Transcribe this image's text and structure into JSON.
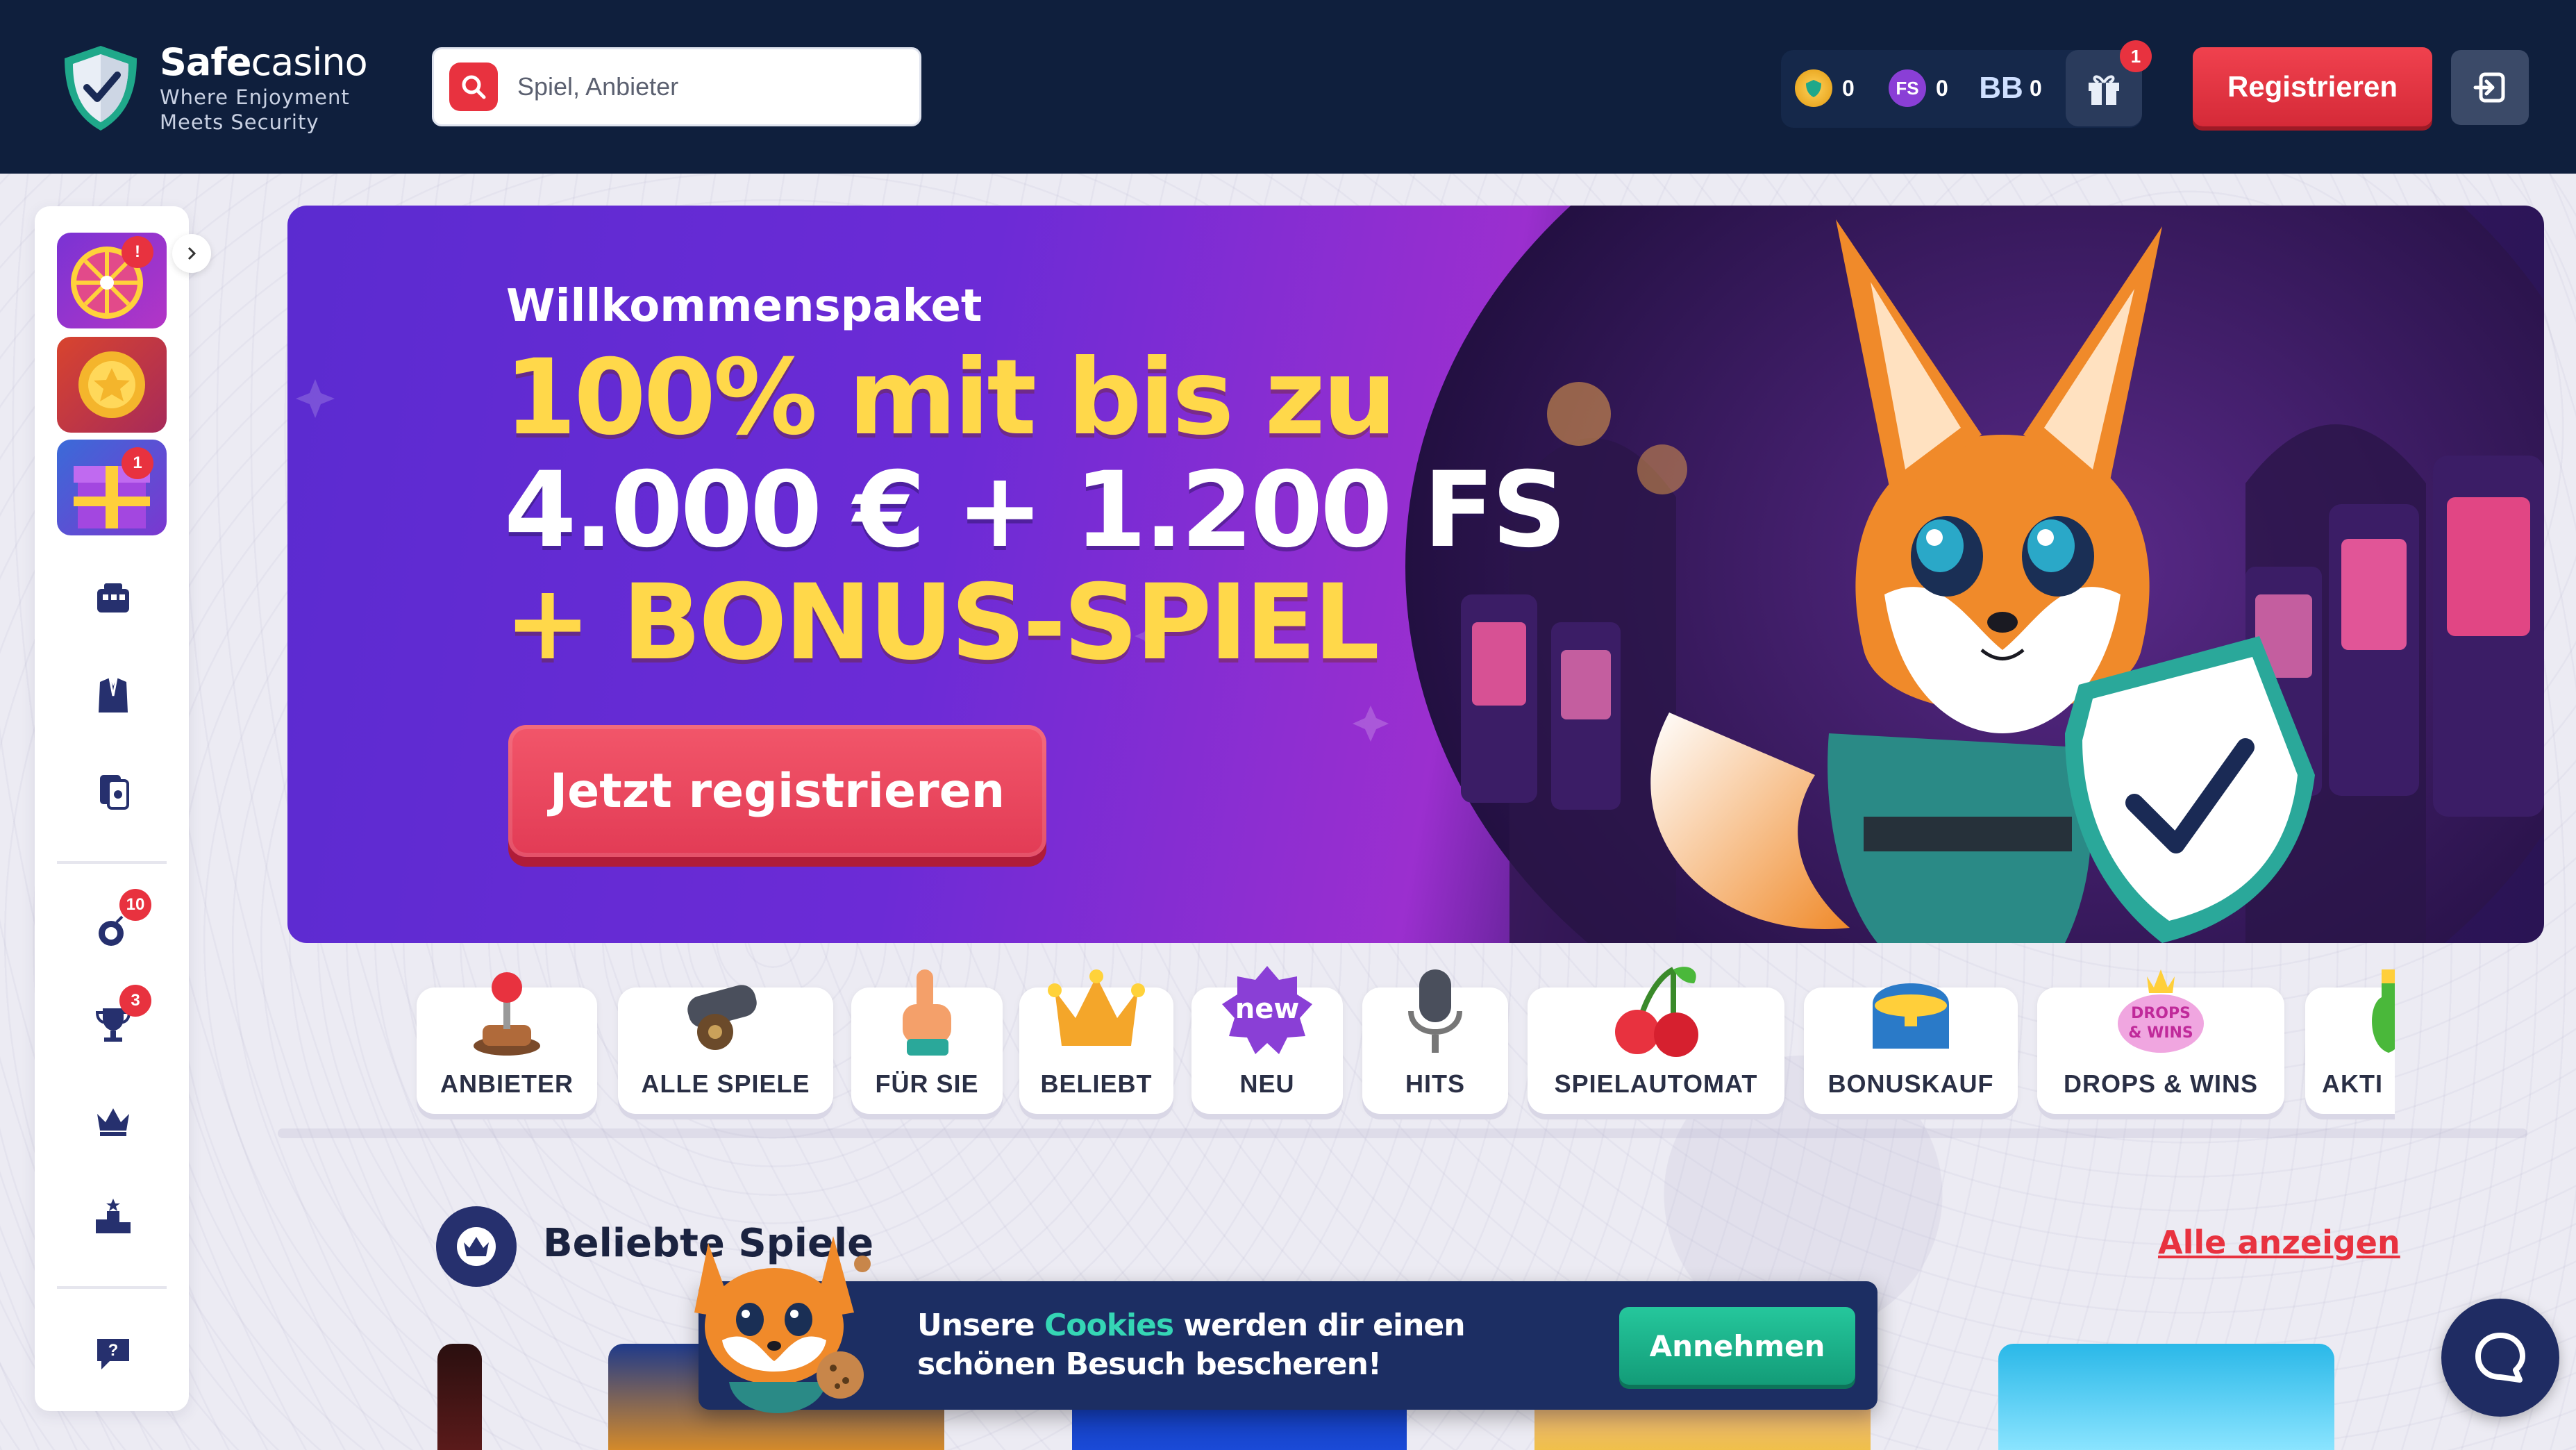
{
  "header": {
    "logo_bold": "Safe",
    "logo_light": "casino",
    "logo_tagline_1": "Where Enjoyment",
    "logo_tagline_2": "Meets Security",
    "search_placeholder": "Spiel, Anbieter",
    "wallet": [
      {
        "icon": "coin-icon",
        "value": "0"
      },
      {
        "icon": "free-spins-icon",
        "label": "FS",
        "value": "0"
      },
      {
        "icon": "bonus-balance-icon",
        "label": "BB",
        "value": "0"
      }
    ],
    "gift_badge": "1",
    "register_label": "Registrieren"
  },
  "sidebar": {
    "badges": {
      "bomb": "10",
      "trophy": "3",
      "gift_tile": "1",
      "wheel_tile": "!"
    }
  },
  "hero": {
    "kicker": "Willkommenspaket",
    "line1": "100% mit bis zu",
    "line2": "4.000 € + 1.200 FS",
    "line3": "+ BONUS-SPIEL",
    "cta": "Jetzt registrieren",
    "slides": 3,
    "active_slide": 1
  },
  "categories": [
    {
      "label": "ANBIETER",
      "icon": "joystick-icon"
    },
    {
      "label": "ALLE SPIELE",
      "icon": "cannon-icon"
    },
    {
      "label": "FÜR SIE",
      "icon": "pointing-hand-icon"
    },
    {
      "label": "BELIEBT",
      "icon": "crown-icon"
    },
    {
      "label": "NEU",
      "icon": "new-badge-icon",
      "art_text": "new"
    },
    {
      "label": "HITS",
      "icon": "microphone-icon"
    },
    {
      "label": "SPIELAUTOMAT",
      "icon": "cherry-icon"
    },
    {
      "label": "BONUSKAUF",
      "icon": "treasure-chest-icon"
    },
    {
      "label": "DROPS & WINS",
      "icon": "drops-wins-icon",
      "art_text": "DROPS & WINS"
    },
    {
      "label": "AKTI",
      "icon": "potion-icon"
    }
  ],
  "popular": {
    "title": "Beliebte Spiele",
    "show_all": "Alle anzeigen"
  },
  "cookie": {
    "text_before": "Unsere ",
    "link": "Cookies",
    "text_after": " werden dir einen schönen Besuch bescheren!",
    "accept": "Annehmen"
  },
  "colors": {
    "header_bg": "#0f1f3d",
    "accent_red": "#e8323f",
    "accept_green": "#1fb48c",
    "hero_yellow": "#ffd84a"
  }
}
